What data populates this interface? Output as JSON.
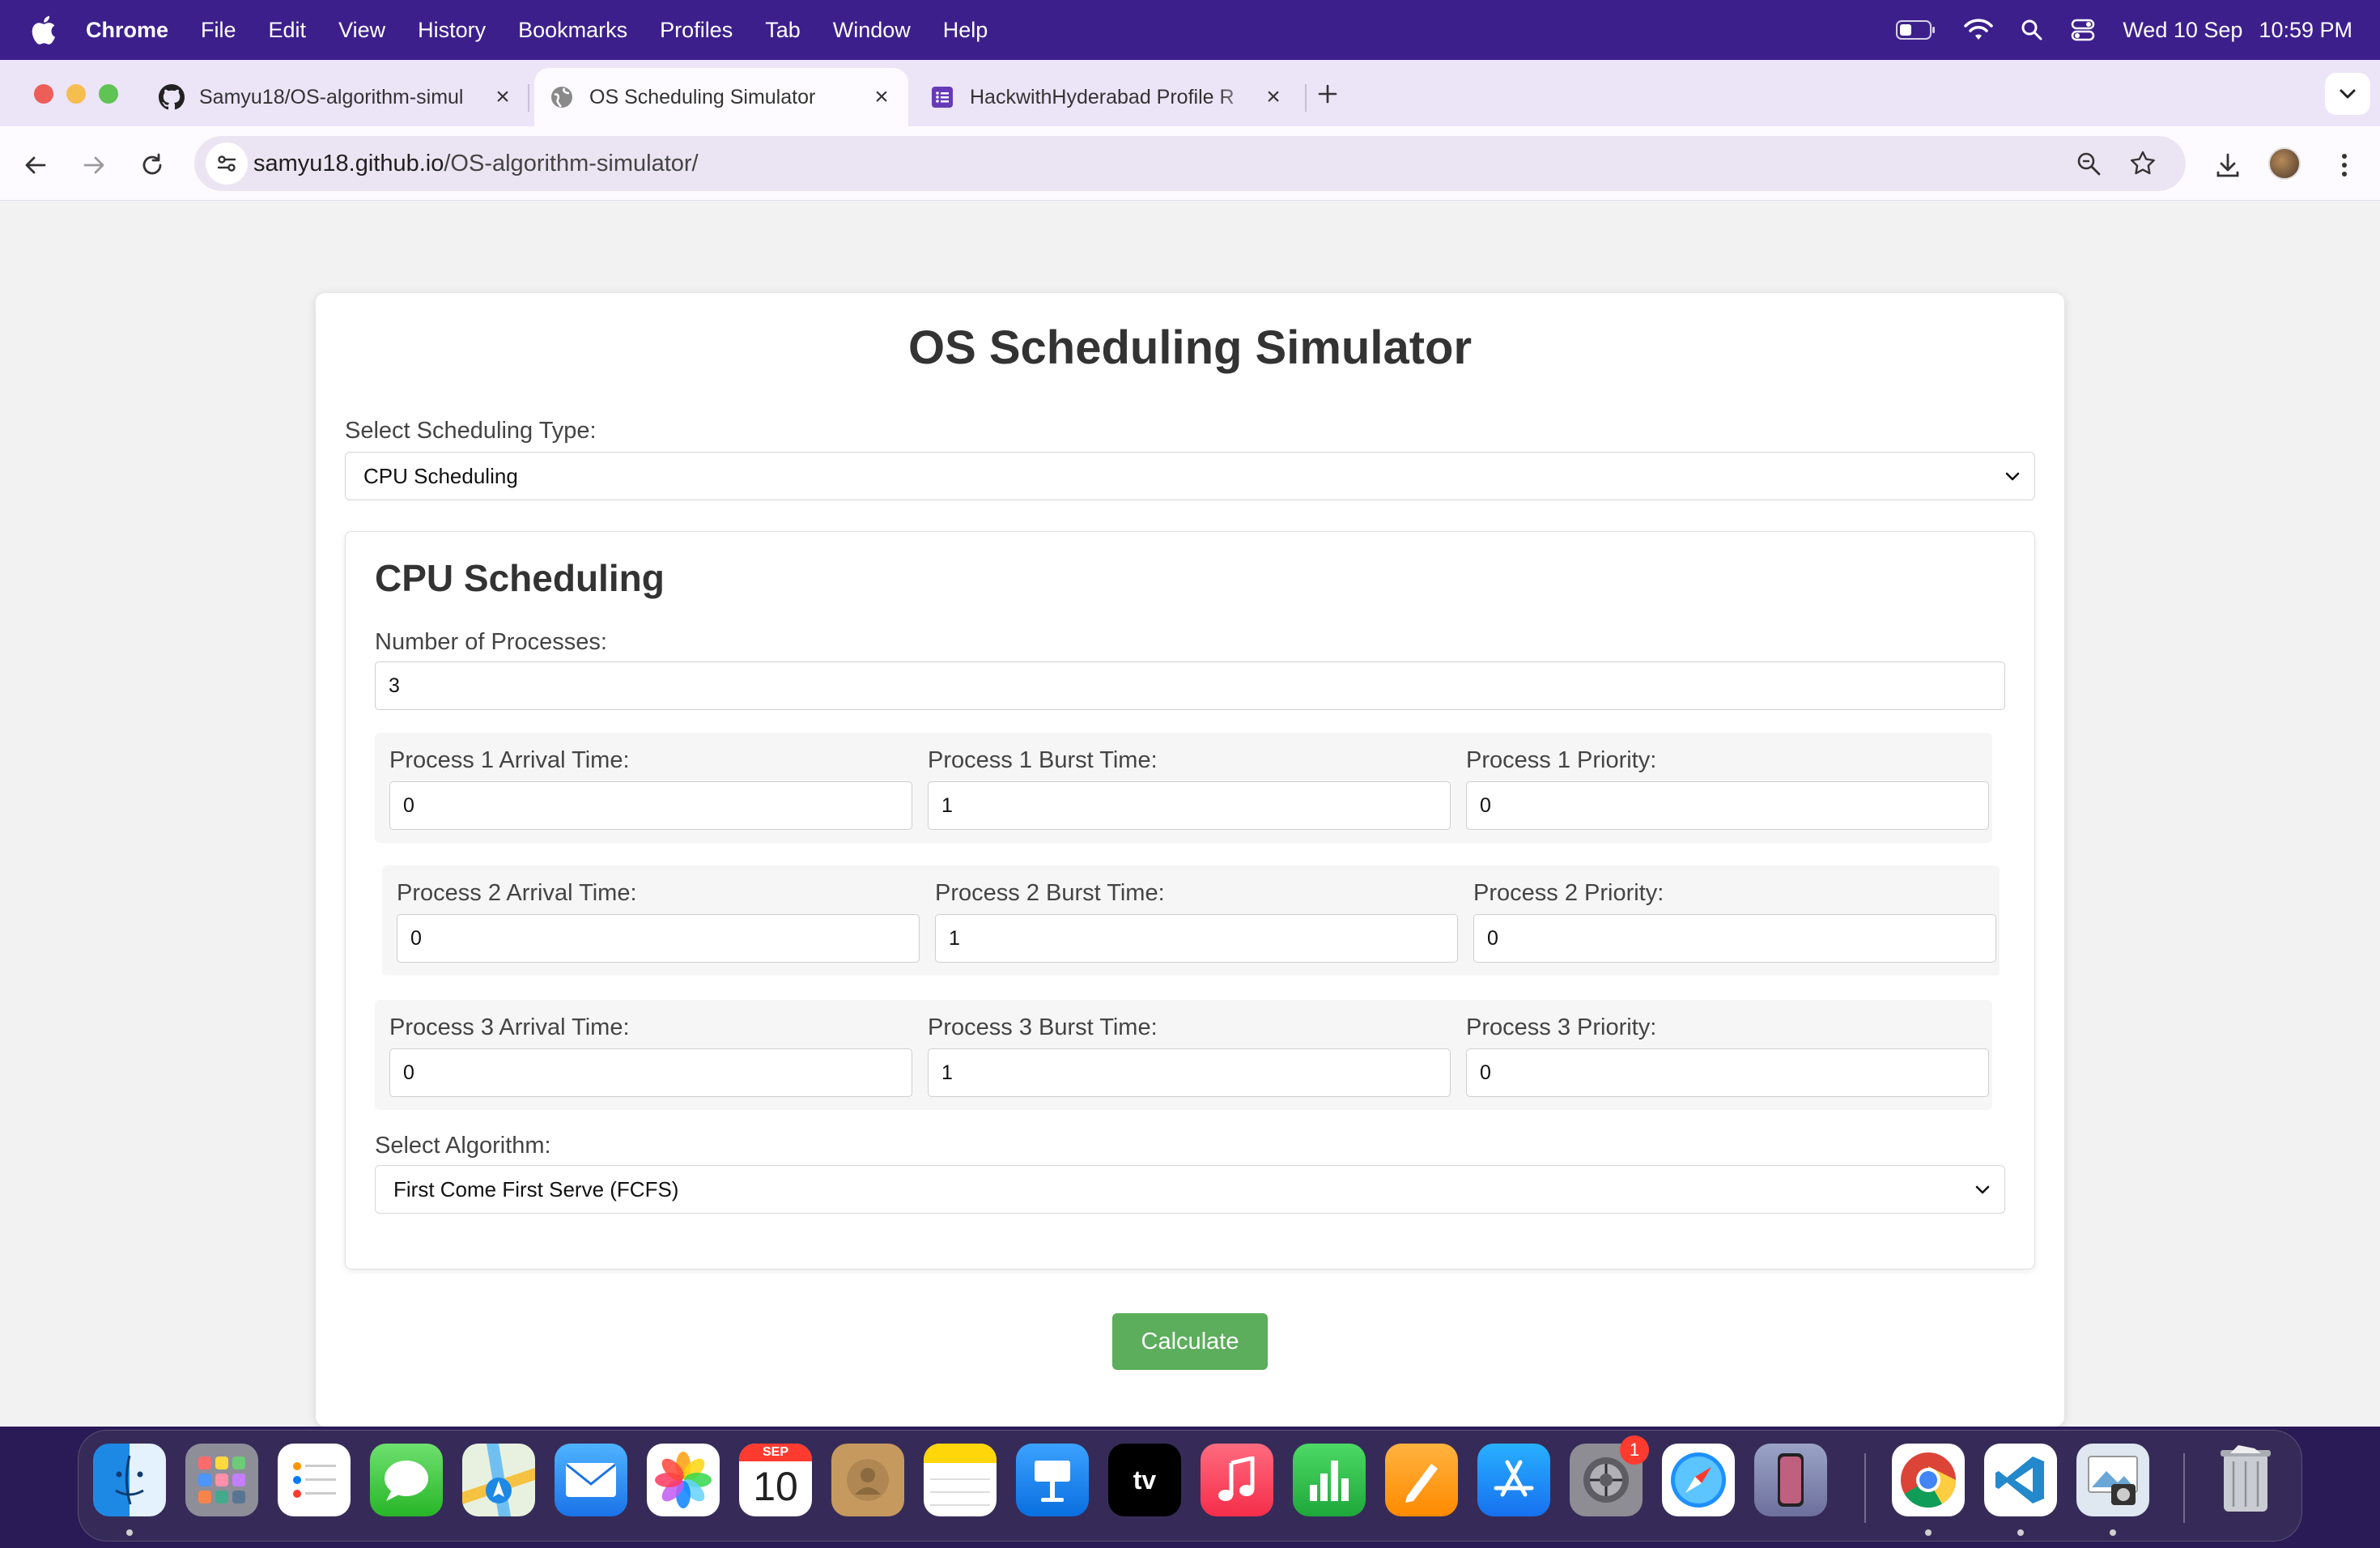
{
  "menubar": {
    "app": "Chrome",
    "items": [
      "File",
      "Edit",
      "View",
      "History",
      "Bookmarks",
      "Profiles",
      "Tab",
      "Window",
      "Help"
    ],
    "date": "Wed 10 Sep",
    "time": "10:59 PM"
  },
  "tabs": [
    {
      "title": "Samyu18/OS-algorithm-simul",
      "icon": "github-icon"
    },
    {
      "title": "OS Scheduling Simulator",
      "icon": "globe-icon",
      "active": true
    },
    {
      "title": "HackwithHyderabad Profile R",
      "icon": "forms-icon"
    }
  ],
  "omnibox": {
    "host": "samyu18.github.io",
    "path": "/OS-algorithm-simulator/"
  },
  "page": {
    "title": "OS Scheduling Simulator",
    "type_label": "Select Scheduling Type:",
    "type_value": "CPU Scheduling",
    "section_title": "CPU Scheduling",
    "num_label": "Number of Processes:",
    "num_value": "3",
    "processes": [
      {
        "arrival_label": "Process 1 Arrival Time:",
        "arrival": "0",
        "burst_label": "Process 1 Burst Time:",
        "burst": "1",
        "priority_label": "Process 1 Priority:",
        "priority": "0"
      },
      {
        "arrival_label": "Process 2 Arrival Time:",
        "arrival": "0",
        "burst_label": "Process 2 Burst Time:",
        "burst": "1",
        "priority_label": "Process 2 Priority:",
        "priority": "0"
      },
      {
        "arrival_label": "Process 3 Arrival Time:",
        "arrival": "0",
        "burst_label": "Process 3 Burst Time:",
        "burst": "1",
        "priority_label": "Process 3 Priority:",
        "priority": "0"
      }
    ],
    "algo_label": "Select Algorithm:",
    "algo_value": "First Come First Serve (FCFS)",
    "calc_label": "Calculate"
  },
  "dock": {
    "calendar_month": "SEP",
    "calendar_day": "10",
    "settings_badge": "1",
    "apps": [
      "finder-icon",
      "launchpad-icon",
      "reminders-icon",
      "messages-icon",
      "maps-icon",
      "mail-icon",
      "photos-icon",
      "calendar-icon",
      "contacts-icon",
      "notes-icon",
      "keynote-icon",
      "appletv-icon",
      "music-icon",
      "numbers-icon",
      "pages-icon",
      "appstore-icon",
      "settings-icon",
      "safari-icon",
      "iphone-mirroring-icon",
      "chrome-icon",
      "vscode-icon",
      "preview-icon",
      "trash-icon"
    ]
  },
  "colors": {
    "menubar": "#3d1f8c",
    "calculate_button": "#5cad5c",
    "tabstrip": "#ece4f7"
  }
}
